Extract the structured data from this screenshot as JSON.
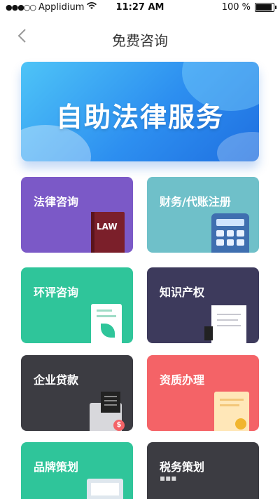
{
  "status_bar": {
    "carrier": "Applidium",
    "time": "11:27 AM",
    "battery": "100 %"
  },
  "navbar": {
    "back_icon": "chevron-left-icon",
    "title": "免费咨询"
  },
  "banner": {
    "title": "自助法律服务"
  },
  "services": [
    {
      "label": "法律咨询",
      "icon": "law-book-icon",
      "icon_text": "LAW",
      "color": "#7b59c7"
    },
    {
      "label": "财务/代账注册",
      "icon": "calculator-icon",
      "color": "#6fc0c9"
    },
    {
      "label": "环评咨询",
      "icon": "leaf-document-icon",
      "color": "#2fc59a"
    },
    {
      "label": "知识产权",
      "icon": "certificate-icon",
      "color": "#3d3a5c"
    },
    {
      "label": "企业贷款",
      "icon": "folder-money-icon",
      "icon_text": "$",
      "color": "#3c3c42"
    },
    {
      "label": "资质办理",
      "icon": "award-certificate-icon",
      "color": "#f46367"
    },
    {
      "label": "品牌策划",
      "icon": "monitor-icon",
      "color": "#2fc59a"
    },
    {
      "label": "税务策划",
      "icon": "tax-icon",
      "color": "#3c3c42"
    }
  ]
}
